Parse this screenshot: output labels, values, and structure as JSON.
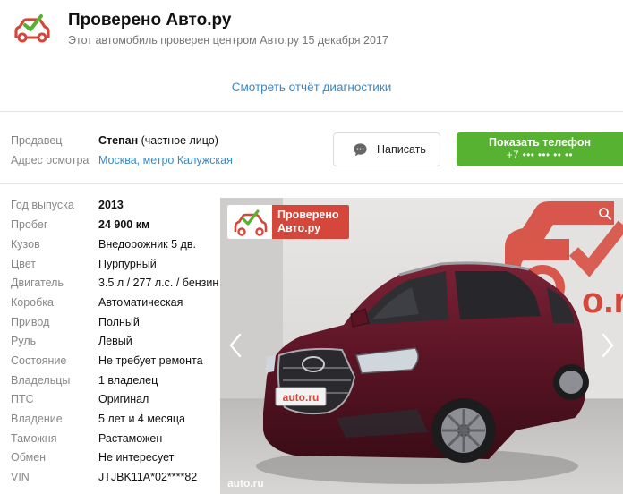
{
  "verified": {
    "title": "Проверено Авто.ру",
    "subtitle": "Этот автомобиль проверен центром Авто.ру 15 декабря 2017",
    "report_link": "Смотреть отчёт диагностики",
    "logo_icon": "car-check-icon",
    "brand_color": "#d6473b",
    "check_color": "#56b230"
  },
  "seller": {
    "seller_label": "Продавец",
    "seller_name": "Степан",
    "seller_type": " (частное лицо)",
    "address_label": "Адрес осмотра",
    "address": "Москва, метро Калужская",
    "write_button": "Написать",
    "write_icon": "chat-bubble-icon",
    "phone_button": "Показать телефон",
    "phone_masked": "+7 ••• ••• •• ••",
    "phone_button_color": "#56b230",
    "link_color": "#3b88c4"
  },
  "specs": [
    {
      "label": "Год выпуска",
      "value": "2013",
      "bold": true
    },
    {
      "label": "Пробег",
      "value": "24 900 км",
      "bold": true
    },
    {
      "label": "Кузов",
      "value": "Внедорожник 5 дв."
    },
    {
      "label": "Цвет",
      "value": "Пурпурный"
    },
    {
      "label": "Двигатель",
      "value": "3.5 л / 277 л.с. / бензин"
    },
    {
      "label": "Коробка",
      "value": "Автоматическая"
    },
    {
      "label": "Привод",
      "value": "Полный"
    },
    {
      "label": "Руль",
      "value": "Левый"
    },
    {
      "label": "Состояние",
      "value": "Не требует ремонта"
    },
    {
      "label": "Владельцы",
      "value": "1 владелец"
    },
    {
      "label": "ПТС",
      "value": "Оригинал"
    },
    {
      "label": "Владение",
      "value": "5 лет и 4 месяца"
    },
    {
      "label": "Таможня",
      "value": "Растаможен"
    },
    {
      "label": "Обмен",
      "value": "Не интересует"
    },
    {
      "label": "VIN",
      "value": "JTJBK11A*02****82"
    }
  ],
  "photo": {
    "badge_line1": "Проверено",
    "badge_line2": "Авто.ру",
    "plate_text": "auto.ru",
    "watermark": "auto.ru",
    "wall_text": "o.r",
    "prev_icon": "chevron-left-icon",
    "next_icon": "chevron-right-icon",
    "zoom_icon": "zoom-icon",
    "car_color": "#5a1424"
  }
}
